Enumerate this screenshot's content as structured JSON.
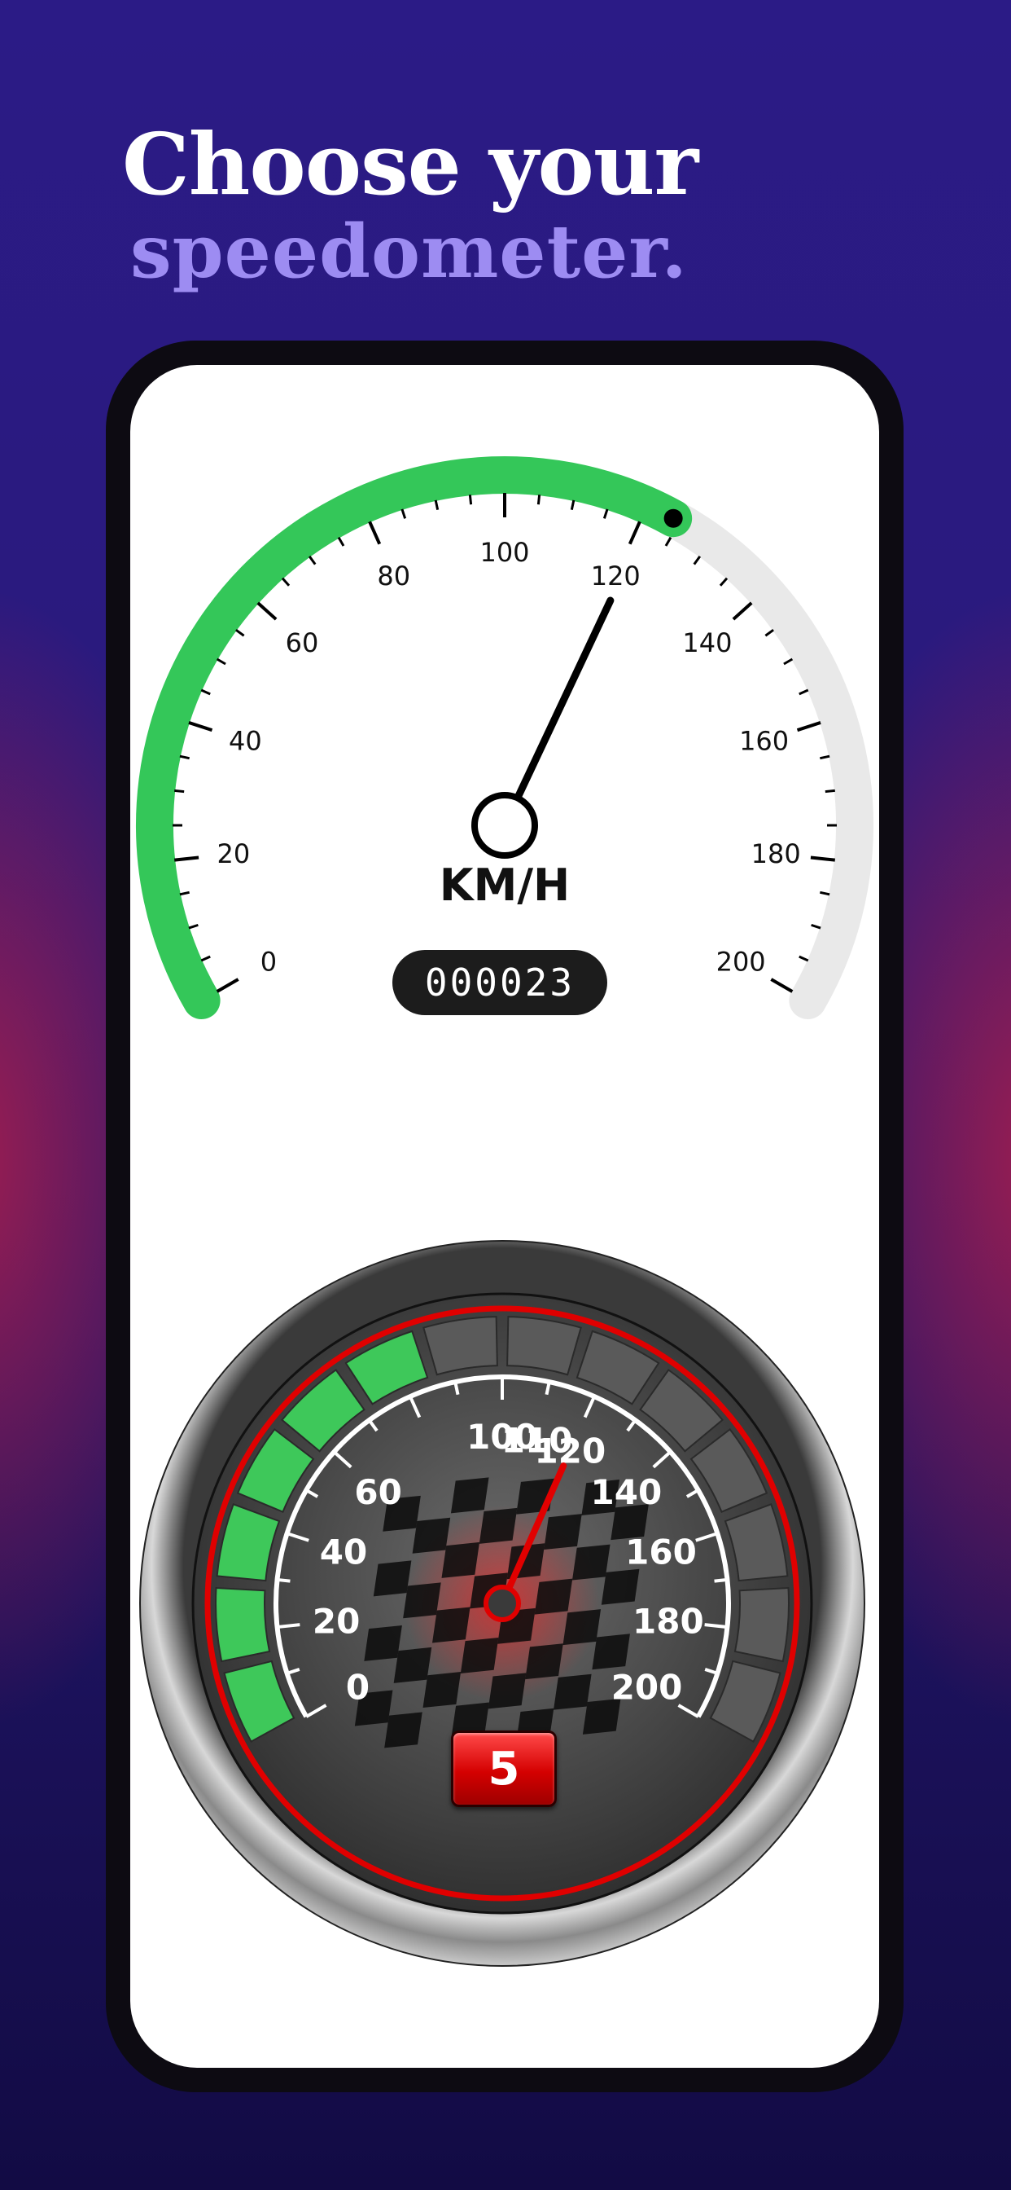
{
  "headline": {
    "line1": "Choose your",
    "line2": "speedometer."
  },
  "speedometer_minimal": {
    "ticks": [
      "0",
      "20",
      "40",
      "60",
      "80",
      "100",
      "120",
      "140",
      "160",
      "180",
      "200"
    ],
    "unit": "KM/H",
    "odometer": "000023",
    "needle_speed": 121,
    "green_arc_end_speed": 124,
    "colors": {
      "active_arc": "#34c759",
      "inactive_arc": "#e9e9e9",
      "needle": "#000000"
    }
  },
  "speedometer_racing": {
    "ticks": [
      "0",
      "20",
      "40",
      "60",
      "100",
      "110",
      "120",
      "140",
      "160",
      "180",
      "200"
    ],
    "needle_speed": 120,
    "gear": "5",
    "lit_segments": 6,
    "total_segments": 14,
    "colors": {
      "needle": "#e10000",
      "ring": "#e00000",
      "segment_on": "#3ec85a",
      "segment_off": "#5a5a5a"
    }
  }
}
